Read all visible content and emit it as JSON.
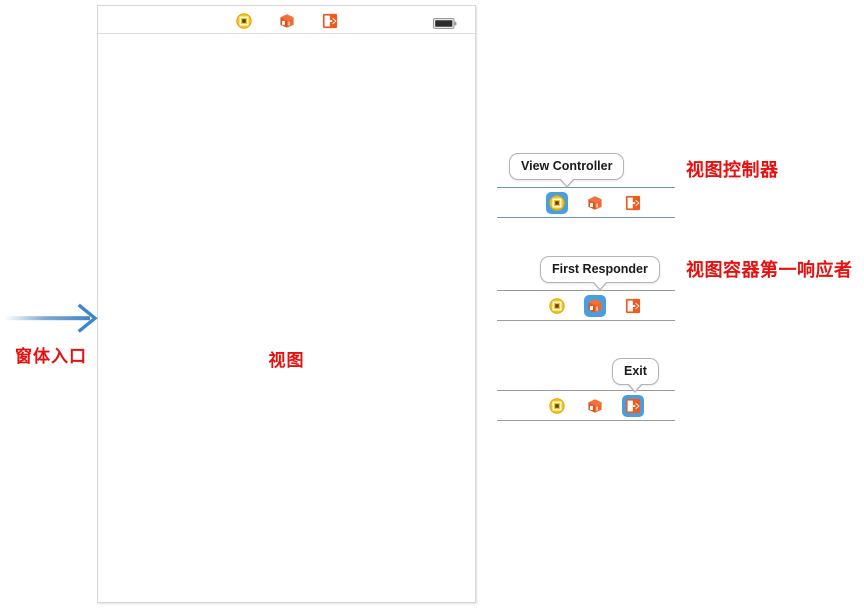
{
  "canvas": {
    "scene_frame_name": "iphone-scene-frame",
    "status_bar": {
      "battery_icon": "battery-full-icon",
      "dock_icons": [
        {
          "icon": "view-controller-icon",
          "label": "View Controller"
        },
        {
          "icon": "first-responder-cube-icon",
          "label": "First Responder"
        },
        {
          "icon": "exit-segue-icon",
          "label": "Exit"
        }
      ]
    },
    "view_label": "视图"
  },
  "left_annotation": {
    "arrow_icon": "entry-point-arrow-icon",
    "label": "窗体入口",
    "arrow_color": "#3f86c6"
  },
  "object_groups": [
    {
      "name": "view-controller-group",
      "callout": "View Controller",
      "callout_target_index": 0,
      "rule_color": "#6e99a8",
      "icons": [
        {
          "icon": "view-controller-icon",
          "selected": true
        },
        {
          "icon": "first-responder-cube-icon",
          "selected": false
        },
        {
          "icon": "exit-segue-icon",
          "selected": false
        }
      ],
      "note": "视图控制器"
    },
    {
      "name": "first-responder-group",
      "callout": "First Responder",
      "callout_target_index": 1,
      "rule_color": "#9b9b9b",
      "icons": [
        {
          "icon": "view-controller-icon",
          "selected": false
        },
        {
          "icon": "first-responder-cube-icon",
          "selected": true
        },
        {
          "icon": "exit-segue-icon",
          "selected": false
        }
      ],
      "note": "视图容器第一响应者"
    },
    {
      "name": "exit-group",
      "callout": "Exit",
      "callout_target_index": 2,
      "rule_color": "#9b9b9b",
      "icons": [
        {
          "icon": "view-controller-icon",
          "selected": false
        },
        {
          "icon": "first-responder-cube-icon",
          "selected": false
        },
        {
          "icon": "exit-segue-icon",
          "selected": true
        }
      ],
      "note": ""
    }
  ],
  "colors": {
    "annotation_red": "#e8100f",
    "selection_blue": "#479fe0",
    "arrow_blue": "#3f86c6",
    "rule_blue": "#6e99a8",
    "rule_gray": "#9b9b9b",
    "icon_orange": "#ee5b1e",
    "icon_yellow": "#f5c21a"
  }
}
